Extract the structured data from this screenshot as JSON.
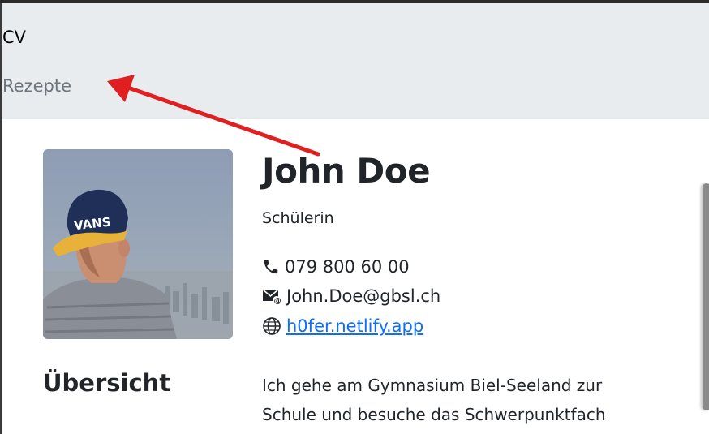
{
  "nav": {
    "cv_label": "CV",
    "rezepte_label": "Rezepte"
  },
  "profile": {
    "name": "John Doe",
    "role": "Schülerin",
    "phone": "079 800 60 00",
    "email": "John.Doe@gbsl.ch",
    "website": "h0fer.netlify.app"
  },
  "overview": {
    "title": "Übersicht",
    "text": "Ich gehe am Gymnasium Biel-Seeland zur Schule und besuche das Schwerpunktfach"
  },
  "colors": {
    "navbar_bg": "#e9ecef",
    "link_blue": "#0d6efd",
    "arrow_red": "#e02020",
    "muted_gray": "#6c757d"
  },
  "icons": [
    "phone-icon",
    "mail-icon",
    "globe-icon",
    "red-arrow-annotation"
  ]
}
